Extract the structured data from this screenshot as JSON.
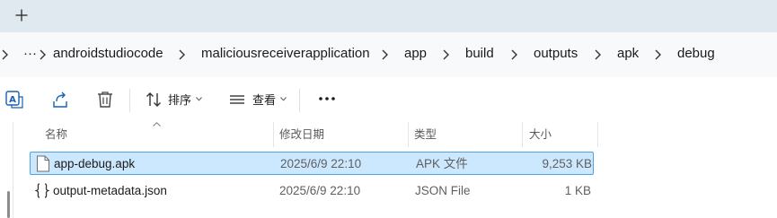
{
  "tabs": {
    "new_tab_icon": "plus-icon"
  },
  "breadcrumb": {
    "overflow": "···",
    "items": [
      "androidstudiocode",
      "maliciousreceiverapplication",
      "app",
      "build",
      "outputs",
      "apk",
      "debug"
    ]
  },
  "toolbar": {
    "translate_icon": "translate-icon",
    "share_icon": "share-icon",
    "delete_icon": "trash-icon",
    "sort_label": "排序",
    "view_label": "查看",
    "more_label": "···"
  },
  "columns": {
    "name": "名称",
    "modified": "修改日期",
    "type": "类型",
    "size": "大小"
  },
  "files": [
    {
      "name": "app-debug.apk",
      "modified": "2025/6/9 22:10",
      "type": "APK 文件",
      "size": "9,253 KB",
      "selected": true,
      "icon": "file-icon"
    },
    {
      "name": "output-metadata.json",
      "modified": "2025/6/9 22:10",
      "type": "JSON File",
      "size": "1 KB",
      "selected": false,
      "icon": "json-file-icon"
    }
  ],
  "colors": {
    "tabstrip": "#dfe9ef",
    "address_bg": "#f8f9fb",
    "selection_bg": "#cce8ff",
    "selection_border": "#4aa3e8"
  }
}
